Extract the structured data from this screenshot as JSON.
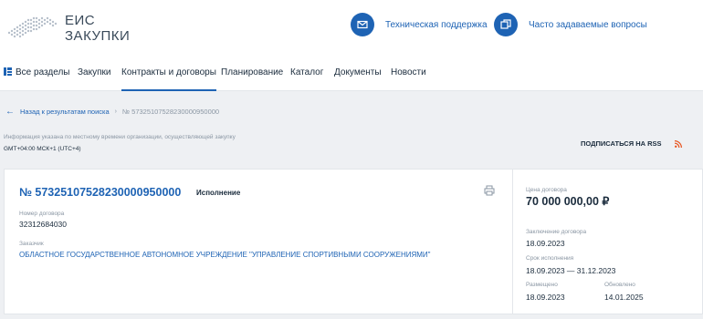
{
  "header": {
    "logo_line1": "ЕИС",
    "logo_line2": "ЗАКУПКИ",
    "support_label": "Техническая поддержка",
    "faq_label": "Часто задаваемые вопросы",
    "accent": "#1e63b4"
  },
  "nav": {
    "items": [
      {
        "label": "Все разделы"
      },
      {
        "label": "Закупки"
      },
      {
        "label": "Контракты и договоры"
      },
      {
        "label": "Планирование"
      },
      {
        "label": "Каталог"
      },
      {
        "label": "Документы"
      },
      {
        "label": "Новости"
      }
    ],
    "active": "Контракты и договоры"
  },
  "breadcrumb": {
    "back_label": "Назад к результатам поиска",
    "separator": "›",
    "current": "№ 57325107528230000950000"
  },
  "info": {
    "text": "Информация указана по местному времени организации, осуществляющей закупку",
    "timezone": "GMT+04:00 МСК+1 (UTC+4)"
  },
  "rss": {
    "label": "ПОДПИСАТЬСЯ НА RSS"
  },
  "card": {
    "contract_number": "№ 57325107528230000950000",
    "status": "Исполнение",
    "number_label": "Номер договора",
    "number_value": "32312684030",
    "customer_label": "Заказчик",
    "customer_value": "ОБЛАСТНОЕ ГОСУДАРСТВЕННОЕ АВТОНОМНОЕ УЧРЕЖДЕНИЕ \"УПРАВЛЕНИЕ СПОРТИВНЫМИ СООРУЖЕНИЯМИ\"",
    "price_label": "Цена договора",
    "price_value": "70 000 000,00 ₽",
    "conclusion_label": "Заключение договора",
    "conclusion_value": "18.09.2023",
    "execution_label": "Срок исполнения",
    "execution_value": "18.09.2023 — 31.12.2023",
    "placed_label": "Размещено",
    "placed_value": "18.09.2023",
    "updated_label": "Обновлено",
    "updated_value": "14.01.2025"
  }
}
